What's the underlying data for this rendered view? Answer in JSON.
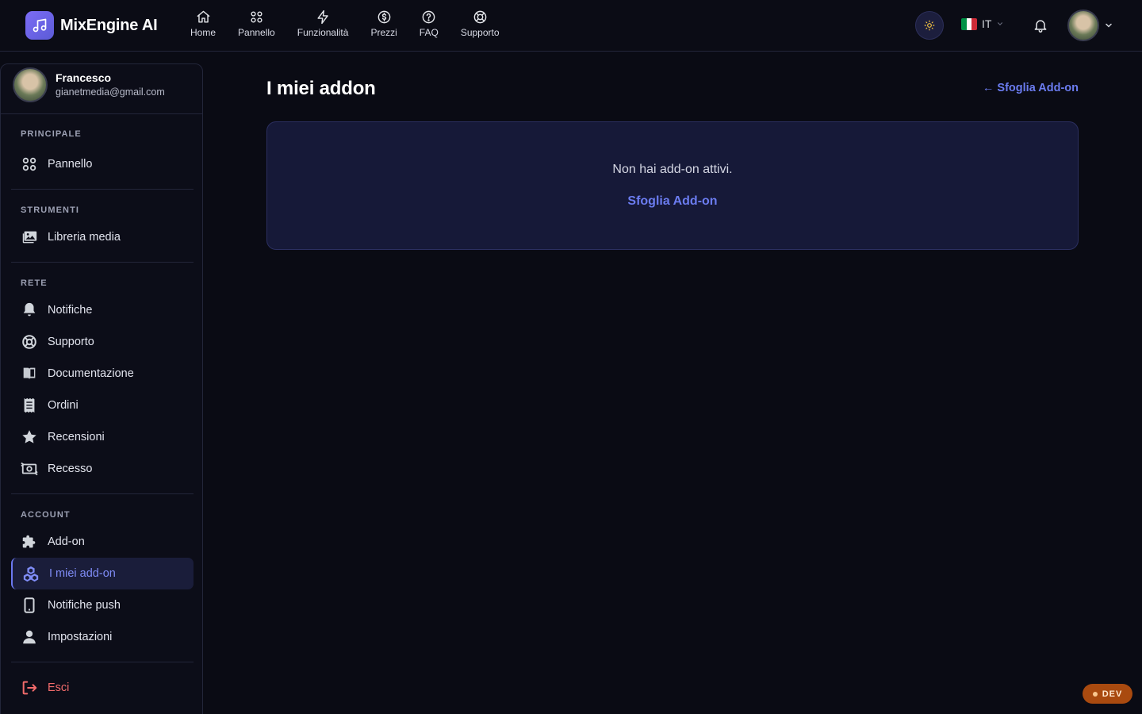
{
  "app": {
    "name": "MixEngine AI"
  },
  "nav": [
    {
      "label": "Home",
      "icon": "home-icon"
    },
    {
      "label": "Pannello",
      "icon": "grid-icon"
    },
    {
      "label": "Funzionalità",
      "icon": "bolt-icon"
    },
    {
      "label": "Prezzi",
      "icon": "dollar-icon"
    },
    {
      "label": "FAQ",
      "icon": "help-icon"
    },
    {
      "label": "Supporto",
      "icon": "lifebuoy-icon"
    }
  ],
  "header": {
    "language": "IT",
    "flag_colors": [
      "#009246",
      "#ffffff",
      "#ce2b37"
    ]
  },
  "user": {
    "name": "Francesco",
    "email": "gianetmedia@gmail.com"
  },
  "sidebar": {
    "sections": [
      {
        "title": "PRINCIPALE",
        "items": [
          {
            "label": "Pannello",
            "icon": "grid-icon"
          }
        ]
      },
      {
        "title": "STRUMENTI",
        "items": [
          {
            "label": "Libreria media",
            "icon": "media-library-icon"
          }
        ]
      },
      {
        "title": "RETE",
        "items": [
          {
            "label": "Notifiche",
            "icon": "bell-icon"
          },
          {
            "label": "Supporto",
            "icon": "lifebuoy-icon"
          },
          {
            "label": "Documentazione",
            "icon": "book-icon"
          },
          {
            "label": "Ordini",
            "icon": "receipt-icon"
          },
          {
            "label": "Recensioni",
            "icon": "star-icon"
          },
          {
            "label": "Recesso",
            "icon": "refund-icon"
          }
        ]
      },
      {
        "title": "ACCOUNT",
        "items": [
          {
            "label": "Add-on",
            "icon": "puzzle-icon"
          },
          {
            "label": "I miei add-on",
            "icon": "cubes-icon",
            "active": true
          },
          {
            "label": "Notifiche push",
            "icon": "mobile-icon"
          },
          {
            "label": "Impostazioni",
            "icon": "user-icon"
          }
        ]
      }
    ],
    "logout": {
      "label": "Esci",
      "icon": "logout-icon"
    }
  },
  "main": {
    "title": "I miei addon",
    "browse_link": "← Sfoglia Add-on",
    "empty_text": "Non hai add-on attivi.",
    "empty_link": "Sfoglia Add-on"
  },
  "badge": {
    "label": "DEV"
  },
  "colors": {
    "accent": "#6b7cf0",
    "danger": "#f26b6b",
    "background": "#0a0b14",
    "card": "#161938"
  }
}
